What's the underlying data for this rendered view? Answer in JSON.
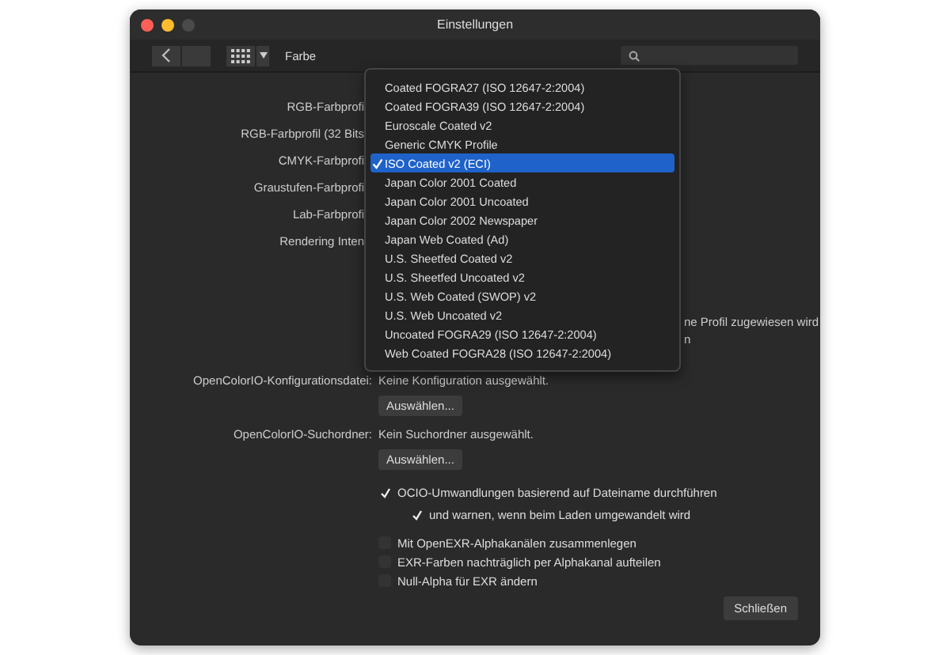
{
  "window": {
    "title": "Einstellungen"
  },
  "toolbar": {
    "section": "Farbe"
  },
  "profile_labels": [
    "RGB-Farbprofi",
    "RGB-Farbprofil (32 Bits",
    "CMYK-Farbprofi",
    "Graustufen-Farbprofi",
    "Lab-Farbprofi",
    "Rendering Inten"
  ],
  "profile_menu": {
    "items": [
      {
        "label": "Coated FOGRA27 (ISO 12647-2:2004)",
        "selected": false
      },
      {
        "label": "Coated FOGRA39 (ISO 12647-2:2004)",
        "selected": false
      },
      {
        "label": "Euroscale Coated v2",
        "selected": false
      },
      {
        "label": "Generic CMYK Profile",
        "selected": false
      },
      {
        "label": "ISO Coated v2 (ECI)",
        "selected": true
      },
      {
        "label": "Japan Color 2001 Coated",
        "selected": false
      },
      {
        "label": "Japan Color 2001 Uncoated",
        "selected": false
      },
      {
        "label": "Japan Color 2002 Newspaper",
        "selected": false
      },
      {
        "label": "Japan Web Coated (Ad)",
        "selected": false
      },
      {
        "label": "U.S. Sheetfed Coated v2",
        "selected": false
      },
      {
        "label": "U.S. Sheetfed Uncoated v2",
        "selected": false
      },
      {
        "label": "U.S. Web Coated (SWOP) v2",
        "selected": false
      },
      {
        "label": "U.S. Web Uncoated v2",
        "selected": false
      },
      {
        "label": "Uncoated FOGRA29 (ISO 12647-2:2004)",
        "selected": false
      },
      {
        "label": "Web Coated FOGRA28 (ISO 12647-2:2004)",
        "selected": false
      }
    ]
  },
  "covered_texts": [
    "ne Profil zugewiesen wird",
    "n"
  ],
  "ocio": [
    {
      "kind": "info",
      "label": "OpenColorIO-Konfigurationsdatei:",
      "value": "Keine Konfiguration ausgewählt."
    },
    {
      "kind": "button",
      "label": "Auswählen..."
    },
    {
      "kind": "info",
      "label": "OpenColorIO-Suchordner:",
      "value": "Kein Suchordner ausgewählt."
    },
    {
      "kind": "button",
      "label": "Auswählen..."
    },
    {
      "kind": "checkbox",
      "label": "OCIO-Umwandlungen basierend auf Dateiname durchführen",
      "checked": true,
      "children": [
        {
          "kind": "checkbox",
          "label": "und warnen, wenn beim Laden umgewandelt wird",
          "checked": true
        }
      ]
    }
  ],
  "exr_options": [
    {
      "label": "Mit OpenEXR-Alphakanälen zusammenlegen",
      "checked": false
    },
    {
      "label": "EXR-Farben nachträglich per Alphakanal aufteilen",
      "checked": false
    },
    {
      "label": "Null-Alpha für EXR ändern",
      "checked": false
    }
  ],
  "footer": {
    "close_button": "Schließen"
  }
}
